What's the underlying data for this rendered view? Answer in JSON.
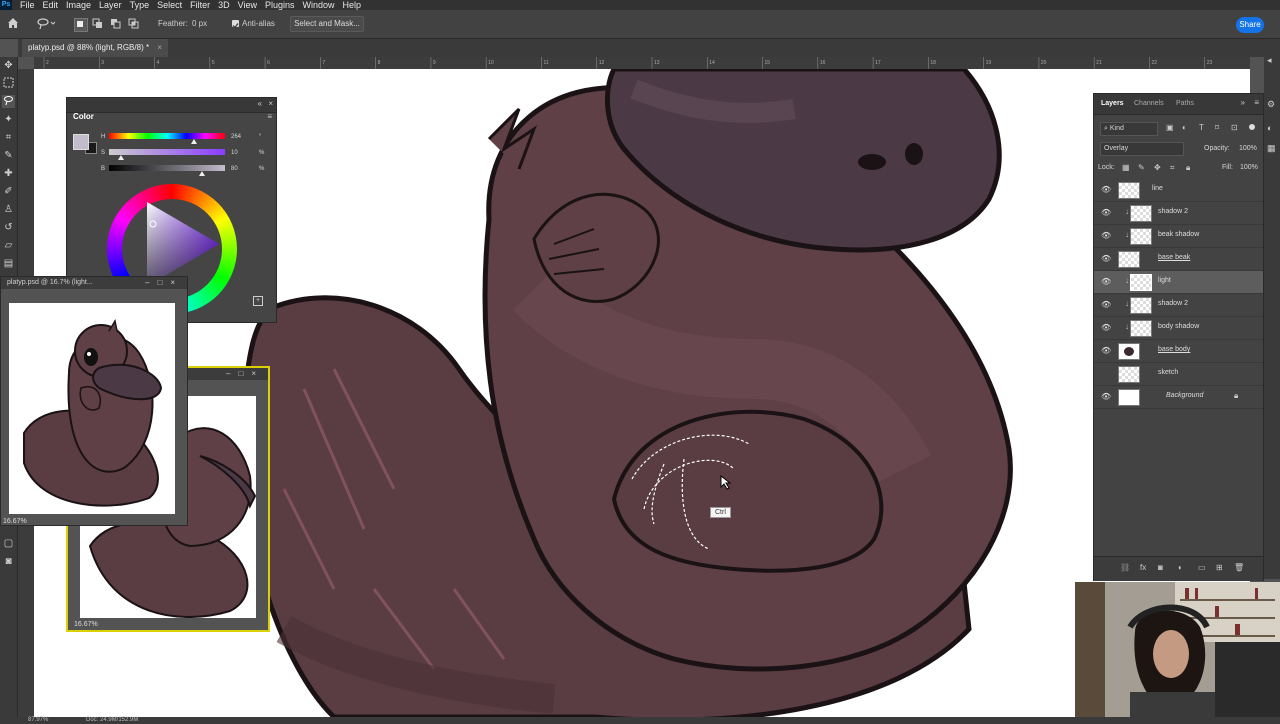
{
  "menubar": {
    "logo": "Ps",
    "items": [
      "File",
      "Edit",
      "Image",
      "Layer",
      "Type",
      "Select",
      "Filter",
      "3D",
      "View",
      "Plugins",
      "Window",
      "Help"
    ]
  },
  "options": {
    "feather_label": "Feather:",
    "feather_value": "0 px",
    "antialias_label": "Anti-alias",
    "select_mask_label": "Select and Mask...",
    "share_label": "Share"
  },
  "document": {
    "tab_title": "platyp.psd @ 88% (light, RGB/8) *",
    "ruler_marks": [
      "2",
      "3",
      "4",
      "5",
      "6",
      "7",
      "8",
      "9",
      "10",
      "11",
      "12",
      "13",
      "14",
      "15",
      "16",
      "17",
      "18",
      "19",
      "20",
      "21",
      "22",
      "23"
    ]
  },
  "color_panel": {
    "title": "Color",
    "h_label": "H",
    "h_value": "264",
    "h_unit": "°",
    "s_label": "S",
    "s_value": "10",
    "s_unit": "%",
    "b_label": "B",
    "b_value": "80",
    "b_unit": "%",
    "h_level": 0.73,
    "s_level": 0.1,
    "b_level": 0.8
  },
  "navigator_1": {
    "title": "platyp.psd @ 16.7% (light...",
    "zoom": "16.67%"
  },
  "navigator_2": {
    "zoom": "16.67%"
  },
  "layers_panel": {
    "tabs": [
      "Layers",
      "Channels",
      "Paths"
    ],
    "filter_kind": "Kind",
    "blend_mode": "Overlay",
    "opacity_label": "Opacity:",
    "opacity_value": "100%",
    "lock_label": "Lock:",
    "fill_label": "Fill:",
    "fill_value": "100%",
    "layers": [
      {
        "name": "line",
        "clip": false,
        "selected": false,
        "visible": true
      },
      {
        "name": "shadow 2",
        "clip": true,
        "selected": false,
        "visible": true
      },
      {
        "name": "beak shadow",
        "clip": true,
        "selected": false,
        "visible": true
      },
      {
        "name": "base beak",
        "clip": false,
        "selected": false,
        "visible": true
      },
      {
        "name": "light",
        "clip": true,
        "selected": true,
        "visible": true
      },
      {
        "name": "shadow 2",
        "clip": true,
        "selected": false,
        "visible": true
      },
      {
        "name": "body shadow",
        "clip": true,
        "selected": false,
        "visible": true
      },
      {
        "name": "base body",
        "clip": false,
        "selected": false,
        "visible": true
      },
      {
        "name": "sketch",
        "clip": false,
        "selected": false,
        "visible": false
      },
      {
        "name": "Background",
        "clip": false,
        "selected": false,
        "visible": true
      }
    ]
  },
  "cursor_tooltip": "Ctrl",
  "status": {
    "zoom": "87.97%",
    "doc": "Doc: 24.9M/152.9M"
  },
  "colors": {
    "accent": "#1473e6",
    "body_fill": "#5b3f44",
    "body_light": "#6e4c52",
    "outline": "#1a1214",
    "beak": "#4b3a45",
    "highlight_stroke": "#8a5865"
  }
}
